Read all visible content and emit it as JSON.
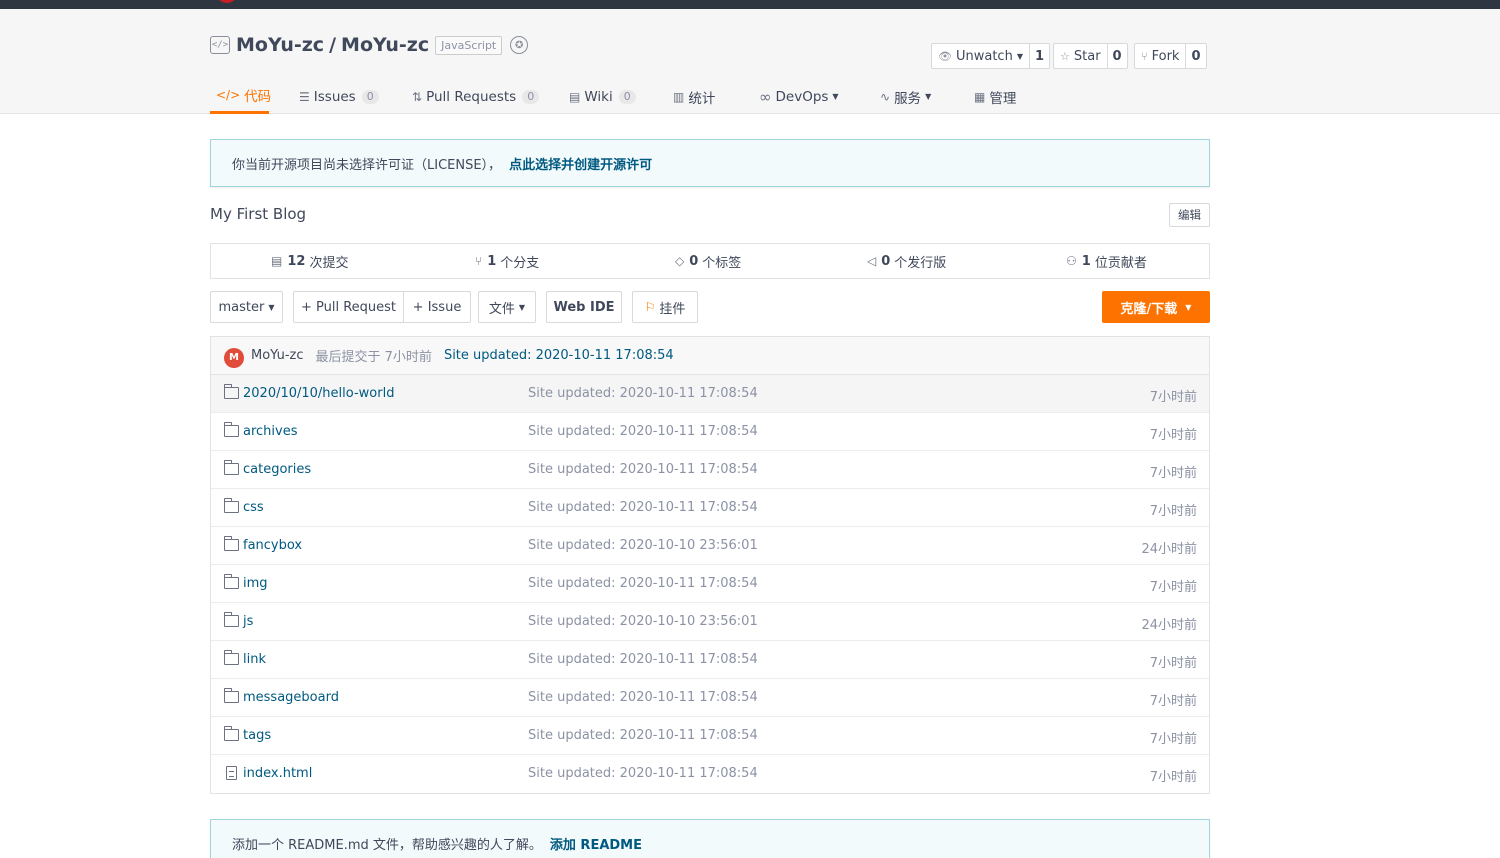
{
  "repo": {
    "owner": "MoYu-zc",
    "separator": "/",
    "name": "MoYu-zc",
    "language": "JavaScript"
  },
  "actions": {
    "watch_label": "Unwatch",
    "watch_count": "1",
    "star_label": "Star",
    "star_count": "0",
    "fork_label": "Fork",
    "fork_count": "0"
  },
  "tabs": [
    {
      "label": "代码",
      "icon": "code-icon"
    },
    {
      "label": "Issues",
      "count": "0",
      "icon": "issues-icon"
    },
    {
      "label": "Pull Requests",
      "count": "0",
      "icon": "pull-request-icon"
    },
    {
      "label": "Wiki",
      "count": "0",
      "icon": "wiki-icon"
    },
    {
      "label": "统计",
      "icon": "bar-chart-icon"
    },
    {
      "label": "DevOps",
      "icon": "infinity-icon"
    },
    {
      "label": "服务",
      "icon": "pulse-icon"
    },
    {
      "label": "管理",
      "icon": "settings-doc-icon"
    }
  ],
  "license_notice": {
    "text": "你当前开源项目尚未选择许可证（LICENSE），",
    "link": "点此选择并创建开源许可"
  },
  "description": "My First Blog",
  "edit_label": "编辑",
  "stats": [
    {
      "num": "12",
      "label": "次提交",
      "icon": "commit-icon"
    },
    {
      "num": "1",
      "label": "个分支",
      "icon": "branch-icon"
    },
    {
      "num": "0",
      "label": "个标签",
      "icon": "tag-icon"
    },
    {
      "num": "0",
      "label": "个发行版",
      "icon": "release-icon"
    },
    {
      "num": "1",
      "label": "位贡献者",
      "icon": "contributors-icon"
    }
  ],
  "toolbar": {
    "branch": "master",
    "pull_request": "+ Pull Request",
    "issue": "+ Issue",
    "file": "文件",
    "web_ide": "Web IDE",
    "plugin": "挂件",
    "clone": "克隆/下载"
  },
  "last_commit": {
    "avatar": "M",
    "author": "MoYu-zc",
    "time": "最后提交于 7小时前",
    "message": "Site updated: 2020-10-11 17:08:54"
  },
  "files": [
    {
      "name": "2020/10/10/hello-world",
      "type": "folder",
      "message": "Site updated: 2020-10-11 17:08:54",
      "time": "7小时前"
    },
    {
      "name": "archives",
      "type": "folder",
      "message": "Site updated: 2020-10-11 17:08:54",
      "time": "7小时前"
    },
    {
      "name": "categories",
      "type": "folder",
      "message": "Site updated: 2020-10-11 17:08:54",
      "time": "7小时前"
    },
    {
      "name": "css",
      "type": "folder",
      "message": "Site updated: 2020-10-11 17:08:54",
      "time": "7小时前"
    },
    {
      "name": "fancybox",
      "type": "folder",
      "message": "Site updated: 2020-10-10 23:56:01",
      "time": "24小时前"
    },
    {
      "name": "img",
      "type": "folder",
      "message": "Site updated: 2020-10-11 17:08:54",
      "time": "7小时前"
    },
    {
      "name": "js",
      "type": "folder",
      "message": "Site updated: 2020-10-10 23:56:01",
      "time": "24小时前"
    },
    {
      "name": "link",
      "type": "folder",
      "message": "Site updated: 2020-10-11 17:08:54",
      "time": "7小时前"
    },
    {
      "name": "messageboard",
      "type": "folder",
      "message": "Site updated: 2020-10-11 17:08:54",
      "time": "7小时前"
    },
    {
      "name": "tags",
      "type": "folder",
      "message": "Site updated: 2020-10-11 17:08:54",
      "time": "7小时前"
    },
    {
      "name": "index.html",
      "type": "file",
      "message": "Site updated: 2020-10-11 17:08:54",
      "time": "7小时前"
    }
  ],
  "readme_notice": {
    "text": "添加一个 README.md 文件，帮助感兴趣的人了解。",
    "link": "添加 README"
  },
  "colors": {
    "accent": "#fe7300",
    "link": "#005980",
    "topbar": "#2e3641"
  }
}
